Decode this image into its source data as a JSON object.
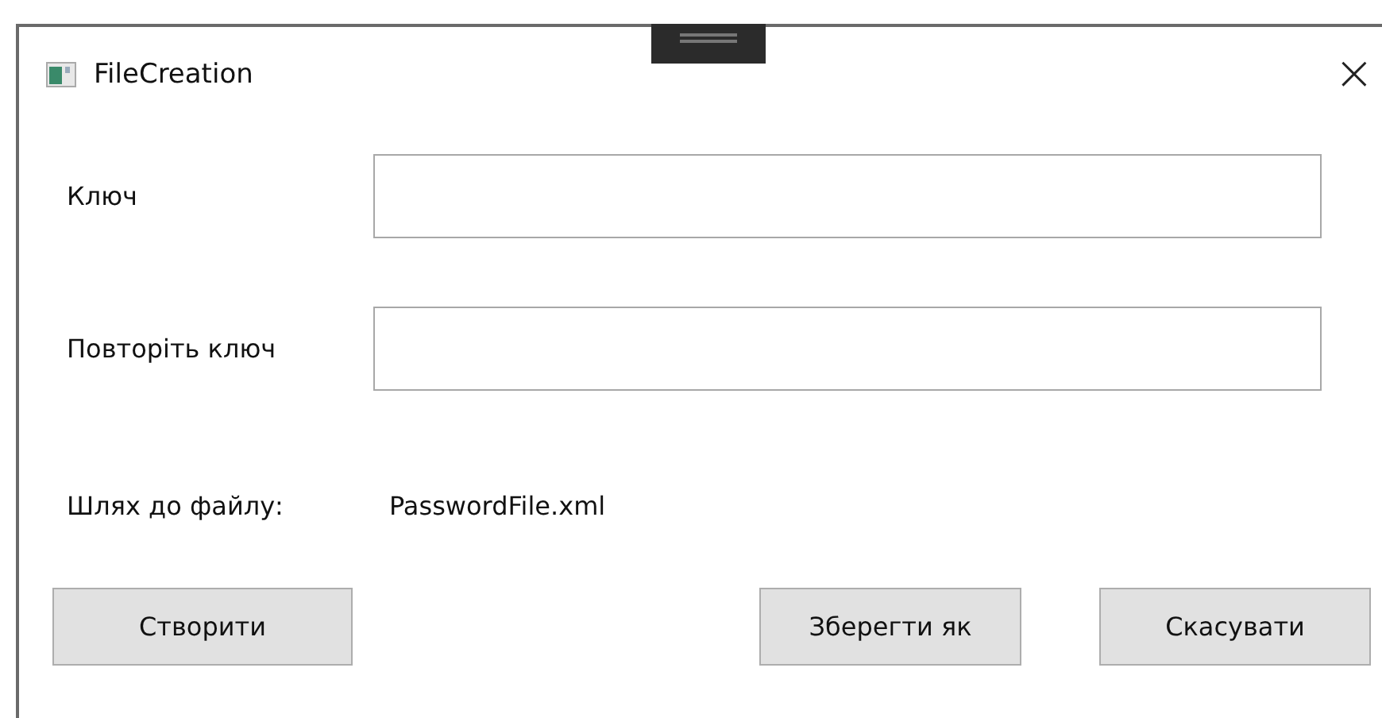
{
  "window": {
    "title": "FileCreation",
    "close": "×"
  },
  "fields": [
    {
      "label": "Ключ"
    },
    {
      "label": "Повторіть ключ"
    }
  ],
  "path": {
    "label": "Шлях до файлу:",
    "value": "PasswordFile.xml"
  },
  "buttons": [
    {
      "label": "Створити"
    },
    {
      "label": "Зберегти як"
    },
    {
      "label": "Скасувати"
    }
  ]
}
